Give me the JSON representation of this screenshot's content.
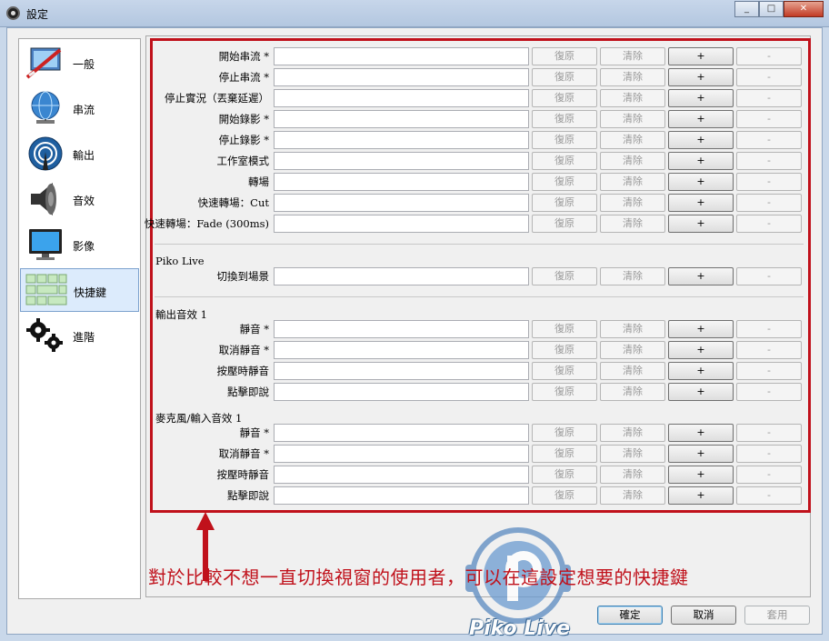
{
  "window": {
    "title": "設定",
    "minimize": "_",
    "maximize": "□",
    "close": "✕"
  },
  "sidebar": {
    "items": [
      {
        "label": "一般",
        "icon": "general-icon"
      },
      {
        "label": "串流",
        "icon": "globe-network-icon"
      },
      {
        "label": "輸出",
        "icon": "broadcast-icon"
      },
      {
        "label": "音效",
        "icon": "speaker-icon"
      },
      {
        "label": "影像",
        "icon": "monitor-icon"
      },
      {
        "label": "快捷鍵",
        "icon": "keyboard-icon",
        "selected": true
      },
      {
        "label": "進階",
        "icon": "gears-icon"
      }
    ]
  },
  "buttons": {
    "restore": "復原",
    "clear": "清除",
    "add": "+",
    "remove": "-"
  },
  "hotkeys": {
    "general": [
      "開始串流 *",
      "停止串流 *",
      "停止實況（丟棄延遲）",
      "開始錄影 *",
      "停止錄影 *",
      "工作室模式",
      "轉場",
      "快速轉場：Cut",
      "快速轉場：Fade (300ms)"
    ],
    "scene_group_title": "Piko Live",
    "scene": [
      "切換到場景"
    ],
    "output_group_title": "輸出音效 1",
    "output": [
      "靜音 *",
      "取消靜音 *",
      "按壓時靜音",
      "點擊即說"
    ],
    "mic_group_title": "麥克風/輸入音效 1",
    "mic": [
      "靜音 *",
      "取消靜音 *",
      "按壓時靜音",
      "點擊即說"
    ]
  },
  "annotation": "對於比較不想一直切換視窗的使用者，可以在這設定想要的快捷鍵",
  "watermark": "Piko Live",
  "dialog": {
    "ok": "確定",
    "cancel": "取消",
    "apply": "套用"
  },
  "colors": {
    "highlight": "#c0111b",
    "selected": "#dcebfc"
  }
}
